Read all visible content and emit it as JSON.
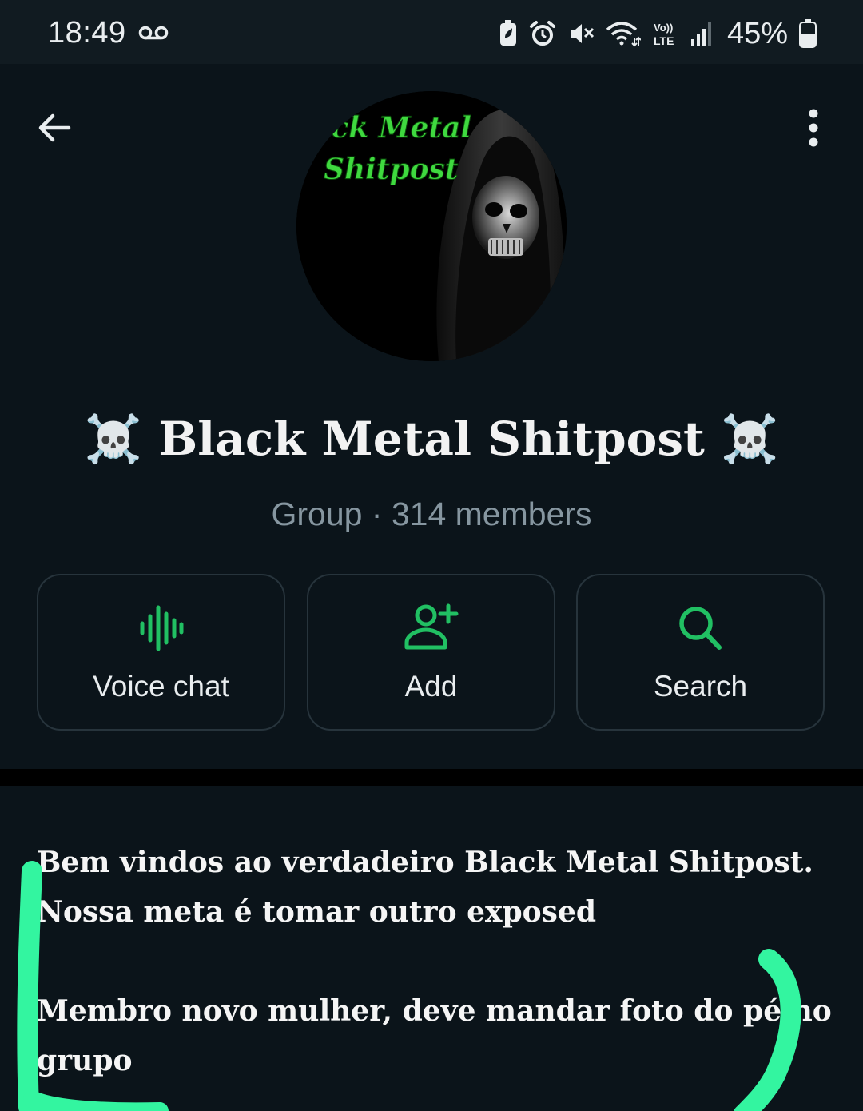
{
  "status_bar": {
    "time": "18:49",
    "battery_percent": "45%",
    "icons": [
      "voicemail-icon",
      "battery-saver-icon",
      "alarm-icon",
      "mute-icon",
      "wifi-icon",
      "volte-icon",
      "signal-icon",
      "battery-icon"
    ],
    "volte_label_top": "Vo))",
    "volte_label_bottom": "LTE"
  },
  "header": {
    "back_icon": "arrow-left-icon",
    "menu_icon": "more-vertical-icon"
  },
  "avatar": {
    "image_text_line1": "ack Metal",
    "image_text_line2": "Shitpost",
    "text_color": "#3fd93f"
  },
  "group": {
    "name": "☠️ Black Metal Shitpost ☠️",
    "subtitle": "Group · 314 members"
  },
  "actions": [
    {
      "label": "Voice chat",
      "icon": "voice-wave-icon"
    },
    {
      "label": "Add",
      "icon": "add-person-icon"
    },
    {
      "label": "Search",
      "icon": "search-icon"
    }
  ],
  "description": {
    "line1": "Bem vindos ao verdadeiro Black Metal Shitpost.",
    "line2": "Nossa meta é tomar outro exposed",
    "line3": "Membro novo mulher, deve mandar foto do pé no",
    "line4": "grupo"
  },
  "colors": {
    "background": "#0b141a",
    "statusbar": "#111b21",
    "accent_green": "#21c063",
    "highlight_marker": "#33f5a0",
    "subtitle_gray": "#8696a0"
  }
}
